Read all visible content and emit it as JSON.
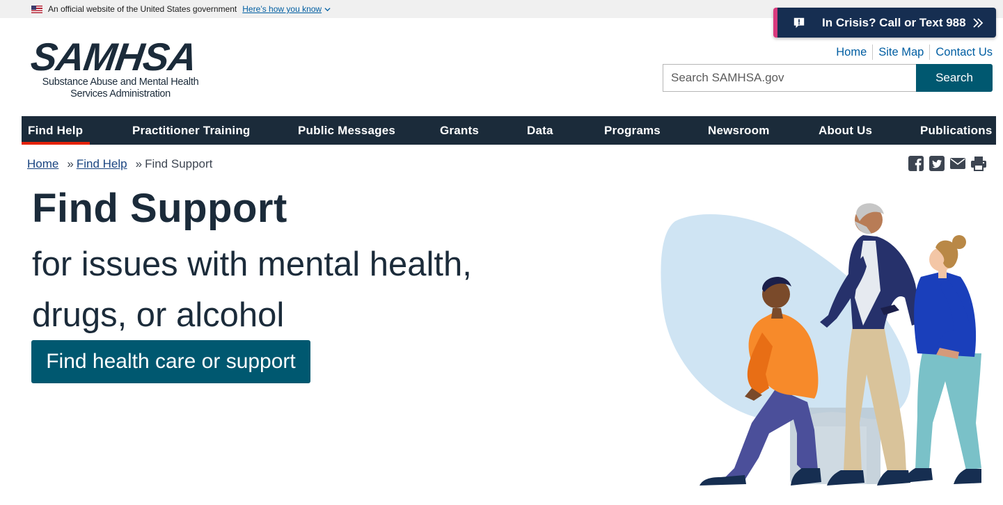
{
  "gov_banner": {
    "text": "An official website of the United States government",
    "link": "Here’s how you know"
  },
  "crisis": {
    "label": "In Crisis? Call or Text 988"
  },
  "logo": {
    "name": "SAMHSA",
    "subtitle_line1": "Substance Abuse and Mental Health",
    "subtitle_line2": "Services Administration"
  },
  "utility_links": {
    "home": "Home",
    "site_map": "Site Map",
    "contact_us": "Contact Us"
  },
  "search": {
    "placeholder": "Search SAMHSA.gov",
    "button": "Search"
  },
  "nav": {
    "items": [
      {
        "label": "Find Help",
        "active": true
      },
      {
        "label": "Practitioner Training"
      },
      {
        "label": "Public Messages"
      },
      {
        "label": "Grants"
      },
      {
        "label": "Data"
      },
      {
        "label": "Programs"
      },
      {
        "label": "Newsroom"
      },
      {
        "label": "About Us"
      },
      {
        "label": "Publications"
      }
    ]
  },
  "breadcrumb": {
    "home": "Home",
    "find_help": "Find Help",
    "current": "Find Support",
    "separator": "»"
  },
  "share_icons": [
    "facebook-icon",
    "twitter-icon",
    "email-icon",
    "print-icon"
  ],
  "hero": {
    "title": "Find Support",
    "subtitle": "for issues with mental health, drugs, or alcohol",
    "cta": "Find health care or support"
  },
  "colors": {
    "navy": "#1b2b3a",
    "teal": "#005870",
    "crisis_bg": "#162e51",
    "crisis_accent": "#d83a7d",
    "nav_active": "#e52207",
    "link": "#005ea2"
  }
}
